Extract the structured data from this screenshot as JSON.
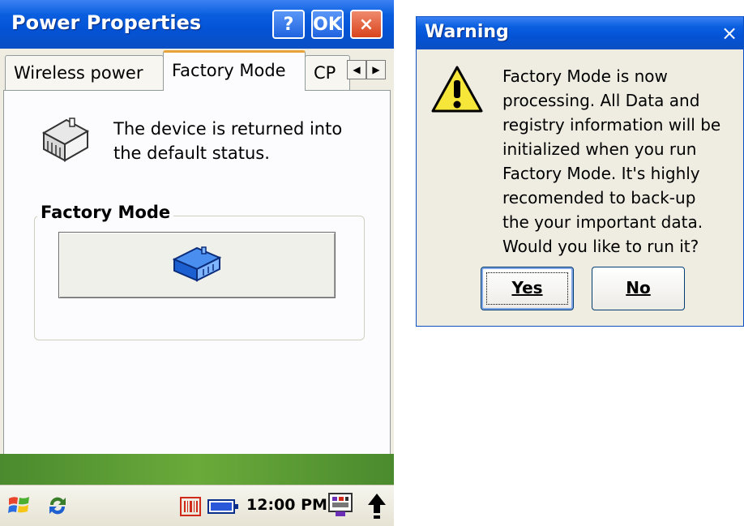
{
  "main_window": {
    "title": "Power Properties",
    "help_button": "?",
    "ok_button": "OK",
    "close_button": "×",
    "tabs": [
      {
        "label": "Wireless power",
        "active": false
      },
      {
        "label": "Factory Mode",
        "active": true
      },
      {
        "label": "CP",
        "active": false
      }
    ],
    "tab_scroll_left": "◀",
    "tab_scroll_right": "▶",
    "description": "The device is returned into\nthe default status.",
    "group_title": "Factory Mode",
    "icons": {
      "info": "factory-house-icon",
      "button": "factory-house-blue-icon"
    }
  },
  "taskbar": {
    "clock": "12:00 PM",
    "icons": [
      "start-flag-icon",
      "sync-icon",
      "barcode-icon",
      "battery-icon",
      "keyboard-icon",
      "up-arrow-icon"
    ]
  },
  "warning_dialog": {
    "title": "Warning",
    "close_button": "×",
    "message": "Factory Mode is now\nprocessing. All Data and\nregistry information will be\ninitialized when you run\nFactory Mode. It's highly\nrecomended to back-up\nthe your important data.\nWould you like to run it?",
    "yes_button": "Yes",
    "no_button": "No",
    "icon": "warning-icon"
  },
  "colors": {
    "titlebar": "#0a5fdf",
    "window_bg": "#efede2",
    "panel_bg": "#fcfcfe",
    "active_tab_accent": "#e8a23a"
  }
}
